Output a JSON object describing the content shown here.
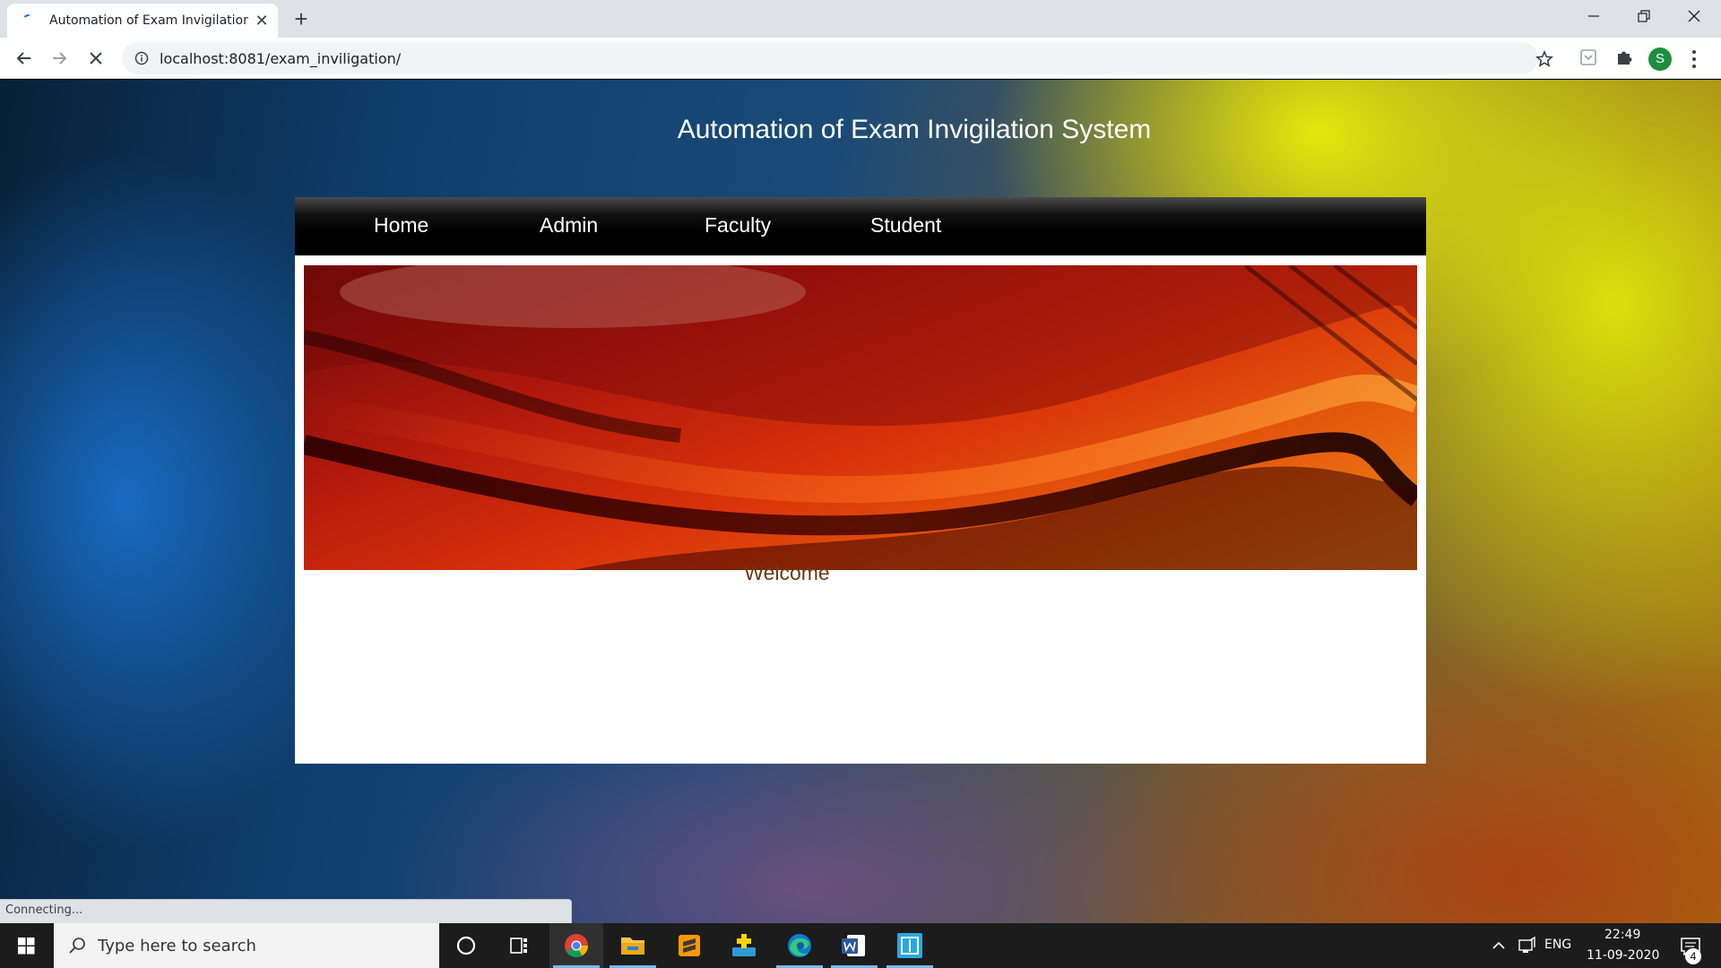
{
  "browser": {
    "tab_title": "Automation of Exam Invigilation",
    "url": "localhost:8081/exam_inviligation/",
    "profile_initial": "S",
    "status_text": "Connecting..."
  },
  "page": {
    "site_title": "Automation of Exam Invigilation System",
    "nav": [
      "Home",
      "Admin",
      "Faculty",
      "Student"
    ],
    "welcome": "Welcome"
  },
  "taskbar": {
    "search_placeholder": "Type here to search",
    "language": "ENG",
    "time": "22:49",
    "date": "11-09-2020",
    "notification_count": "4",
    "apps": [
      "cortana-icon",
      "task-view-icon",
      "chrome-icon",
      "file-explorer-icon",
      "sublime-text-icon",
      "app-installer-icon",
      "edge-icon",
      "word-icon",
      "snip-icon"
    ]
  },
  "colors": {
    "nav_bg": "#000000",
    "welcome_text": "#6b3a14",
    "title_text": "#ffffff"
  }
}
